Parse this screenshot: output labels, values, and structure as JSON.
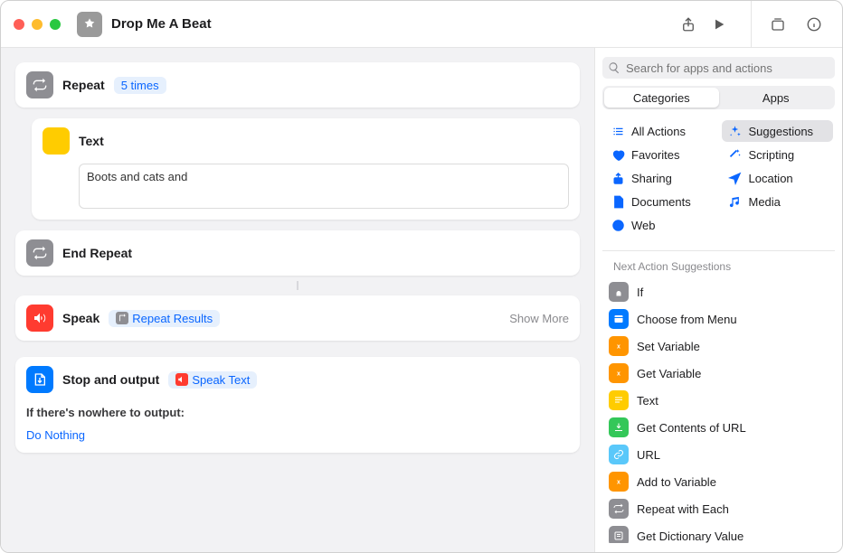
{
  "title": "Drop Me A Beat",
  "search": {
    "placeholder": "Search for apps and actions"
  },
  "tabs": {
    "categories": "Categories",
    "apps": "Apps"
  },
  "categories": [
    {
      "key": "all",
      "label": "All Actions",
      "icon": "list"
    },
    {
      "key": "suggestions",
      "label": "Suggestions",
      "icon": "sparkle",
      "selected": true
    },
    {
      "key": "favorites",
      "label": "Favorites",
      "icon": "heart"
    },
    {
      "key": "scripting",
      "label": "Scripting",
      "icon": "wand"
    },
    {
      "key": "sharing",
      "label": "Sharing",
      "icon": "share"
    },
    {
      "key": "location",
      "label": "Location",
      "icon": "navigate"
    },
    {
      "key": "documents",
      "label": "Documents",
      "icon": "doc"
    },
    {
      "key": "media",
      "label": "Media",
      "icon": "music"
    },
    {
      "key": "web",
      "label": "Web",
      "icon": "safari"
    }
  ],
  "suggestions_header": "Next Action Suggestions",
  "suggestions": [
    {
      "label": "If",
      "color": "si-gray",
      "icon": "branch"
    },
    {
      "label": "Choose from Menu",
      "color": "si-blue",
      "icon": "menu"
    },
    {
      "label": "Set Variable",
      "color": "si-orange",
      "icon": "var"
    },
    {
      "label": "Get Variable",
      "color": "si-orange",
      "icon": "var"
    },
    {
      "label": "Text",
      "color": "si-yellow",
      "icon": "text"
    },
    {
      "label": "Get Contents of URL",
      "color": "si-green",
      "icon": "download"
    },
    {
      "label": "URL",
      "color": "si-lightblue",
      "icon": "link"
    },
    {
      "label": "Add to Variable",
      "color": "si-orange",
      "icon": "var"
    },
    {
      "label": "Repeat with Each",
      "color": "si-gray",
      "icon": "repeat"
    },
    {
      "label": "Get Dictionary Value",
      "color": "si-gray",
      "icon": "dict"
    }
  ],
  "actions": {
    "repeat": {
      "title": "Repeat",
      "count_label": "5 times"
    },
    "text": {
      "title": "Text",
      "content": "Boots and cats and"
    },
    "end_repeat": {
      "title": "End Repeat"
    },
    "speak": {
      "title": "Speak",
      "param": "Repeat Results",
      "show_more": "Show More"
    },
    "stop": {
      "title": "Stop and output",
      "param": "Speak Text",
      "if_label": "If there's nowhere to output:",
      "do_nothing": "Do Nothing"
    }
  }
}
